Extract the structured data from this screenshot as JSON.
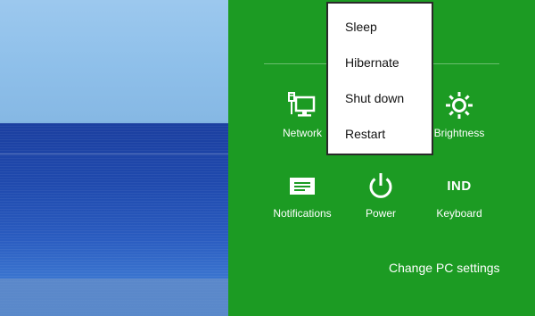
{
  "settings_panel": {
    "tiles": [
      {
        "label": "Network",
        "icon": "network-icon"
      },
      {
        "label": "Brightness",
        "icon": "brightness-icon"
      },
      {
        "label": "Notifications",
        "icon": "notifications-icon"
      },
      {
        "label": "Power",
        "icon": "power-icon"
      },
      {
        "label": "Keyboard",
        "icon": "keyboard-icon",
        "icon_text": "IND"
      }
    ],
    "change_pc_settings": "Change PC settings"
  },
  "power_menu": {
    "items": [
      "Sleep",
      "Hibernate",
      "Shut down",
      "Restart"
    ]
  },
  "colors": {
    "charm_background": "#1c9b23",
    "menu_background": "#ffffff"
  }
}
